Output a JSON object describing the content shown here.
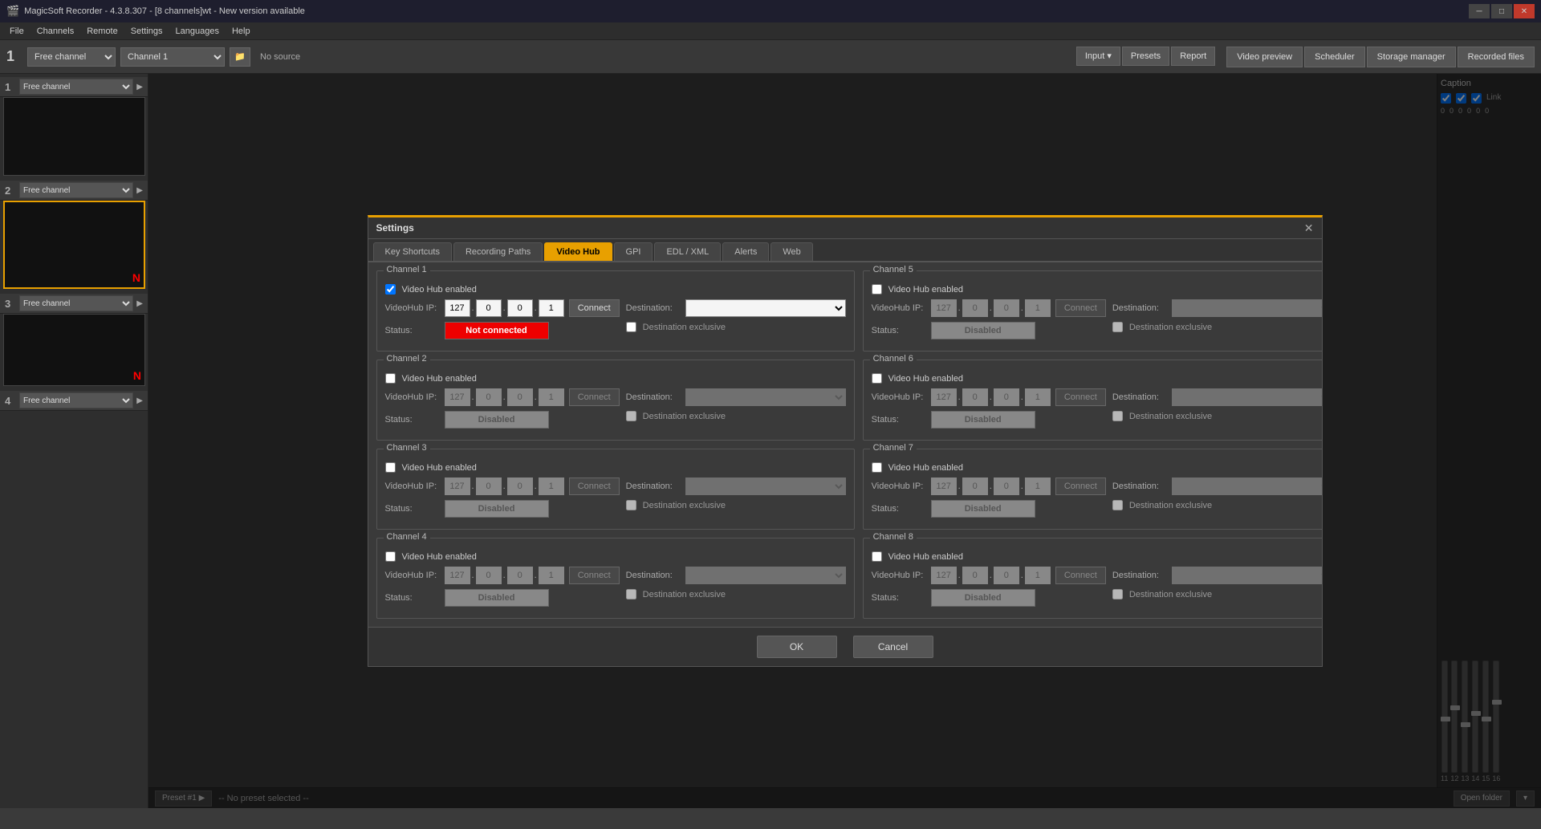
{
  "app": {
    "title": "MagicSoft Recorder - 4.3.8.307 - [8 channels]wt - New version available",
    "icon": "🎬"
  },
  "titlebar": {
    "minimize": "─",
    "maximize": "□",
    "close": "✕"
  },
  "menu": {
    "items": [
      "File",
      "Channels",
      "Remote",
      "Settings",
      "Languages",
      "Help"
    ]
  },
  "toolbar": {
    "channel_num": "1",
    "channel_select": "Free channel",
    "channel2_select": "Channel 1",
    "no_source": "No source",
    "input_label": "Input",
    "presets_label": "Presets",
    "report_label": "Report"
  },
  "top_tabs": [
    {
      "label": "Video preview",
      "active": false
    },
    {
      "label": "Scheduler",
      "active": false
    },
    {
      "label": "Storage manager",
      "active": false
    },
    {
      "label": "Recorded files",
      "active": false
    }
  ],
  "sidebar_channels": [
    {
      "num": "1",
      "name": "Free channel",
      "has_preview": true,
      "active": true,
      "show_n": false
    },
    {
      "num": "2",
      "name": "Free channel",
      "has_preview": true,
      "active": false,
      "show_n": true
    },
    {
      "num": "3",
      "name": "Free channel",
      "has_preview": true,
      "active": false,
      "show_n": true
    },
    {
      "num": "4",
      "name": "Free channel",
      "has_preview": false,
      "active": false,
      "show_n": false
    }
  ],
  "caption": {
    "title": "Caption",
    "link_label": "Link"
  },
  "statusbar": {
    "preset_btn": "Preset #1 ▶",
    "no_preset": "-- No preset selected --",
    "open_folder": "Open folder"
  },
  "modal": {
    "title": "Settings",
    "close": "✕",
    "tabs": [
      {
        "label": "Key Shortcuts",
        "active": false
      },
      {
        "label": "Recording Paths",
        "active": false
      },
      {
        "label": "Video Hub",
        "active": true
      },
      {
        "label": "GPI",
        "active": false
      },
      {
        "label": "EDL / XML",
        "active": false
      },
      {
        "label": "Alerts",
        "active": false
      },
      {
        "label": "Web",
        "active": false
      }
    ],
    "channels": [
      {
        "title": "Channel 1",
        "enabled": true,
        "ip": [
          "127",
          "0",
          "0",
          "1"
        ],
        "status": "Not connected",
        "status_type": "not-connected",
        "dest_exclusive": false,
        "connect_enabled": true
      },
      {
        "title": "Channel 2",
        "enabled": false,
        "ip": [
          "127",
          "0",
          "0",
          "1"
        ],
        "status": "Disabled",
        "status_type": "disabled",
        "dest_exclusive": false,
        "connect_enabled": false
      },
      {
        "title": "Channel 3",
        "enabled": false,
        "ip": [
          "127",
          "0",
          "0",
          "1"
        ],
        "status": "Disabled",
        "status_type": "disabled",
        "dest_exclusive": false,
        "connect_enabled": false
      },
      {
        "title": "Channel 4",
        "enabled": false,
        "ip": [
          "127",
          "0",
          "0",
          "1"
        ],
        "status": "Disabled",
        "status_type": "disabled",
        "dest_exclusive": false,
        "connect_enabled": false
      },
      {
        "title": "Channel 5",
        "enabled": false,
        "ip": [
          "127",
          "0",
          "0",
          "1"
        ],
        "status": "Disabled",
        "status_type": "disabled",
        "dest_exclusive": false,
        "connect_enabled": false
      },
      {
        "title": "Channel 6",
        "enabled": false,
        "ip": [
          "127",
          "0",
          "0",
          "1"
        ],
        "status": "Disabled",
        "status_type": "disabled",
        "dest_exclusive": false,
        "connect_enabled": false
      },
      {
        "title": "Channel 7",
        "enabled": false,
        "ip": [
          "127",
          "0",
          "0",
          "1"
        ],
        "status": "Disabled",
        "status_type": "disabled",
        "dest_exclusive": false,
        "connect_enabled": false
      },
      {
        "title": "Channel 8",
        "enabled": false,
        "ip": [
          "127",
          "0",
          "0",
          "1"
        ],
        "status": "Disabled",
        "status_type": "disabled",
        "dest_exclusive": false,
        "connect_enabled": false
      }
    ],
    "ok_label": "OK",
    "cancel_label": "Cancel"
  },
  "sliders": {
    "labels": [
      "11",
      "12",
      "13",
      "14",
      "15",
      "16"
    ],
    "positions": [
      50,
      40,
      55,
      45,
      50,
      35
    ]
  }
}
